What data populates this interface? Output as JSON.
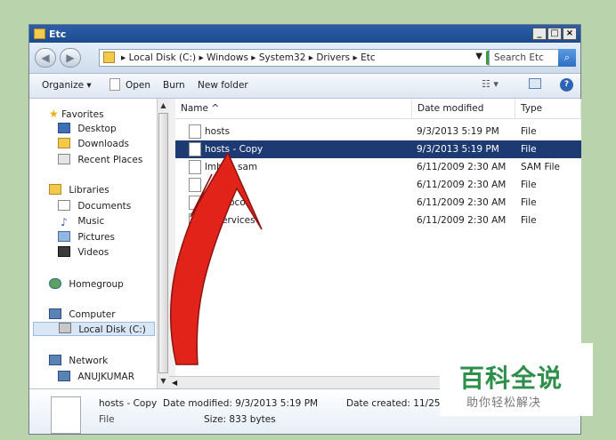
{
  "window": {
    "title": "Etc",
    "buttons": [
      "_",
      "□",
      "×"
    ]
  },
  "address": {
    "path": "▸ Local Disk (C:) ▸ Windows ▸ System32 ▸ Drivers ▸ Etc",
    "search_placeholder": "Search Etc"
  },
  "toolbar": {
    "organize": "Organize ▾",
    "open": "Open",
    "burn": "Burn",
    "new_folder": "New folder",
    "help": "?"
  },
  "sidebar": {
    "favorites": "Favorites",
    "desktop": "Desktop",
    "downloads": "Downloads",
    "recent": "Recent Places",
    "libraries": "Libraries",
    "documents": "Documents",
    "music": "Music",
    "pictures": "Pictures",
    "videos": "Videos",
    "homegroup": "Homegroup",
    "computer": "Computer",
    "local_disk": "Local Disk (C:)",
    "network": "Network",
    "anujkumar": "ANUJKUMAR"
  },
  "columns": {
    "name": "Name ^",
    "date": "Date modified",
    "type": "Type"
  },
  "files": [
    {
      "name": "hosts",
      "date": "9/3/2013 5:19 PM",
      "type": "File"
    },
    {
      "name": "hosts - Copy",
      "date": "9/3/2013 5:19 PM",
      "type": "File"
    },
    {
      "name": "lmh",
      "name2": "sam",
      "date": "6/11/2009 2:30 AM",
      "type": "SAM File"
    },
    {
      "name": "",
      "date": "6/11/2009 2:30 AM",
      "type": "File"
    },
    {
      "name": "toco",
      "date": "6/11/2009 2:30 AM",
      "type": "File"
    },
    {
      "name": "ervices",
      "date": "6/11/2009 2:30 AM",
      "type": "File"
    }
  ],
  "details": {
    "name": "hosts - Copy",
    "kind": "File",
    "modified": "Date modified: 9/3/2013 5:19 PM",
    "size": "Size: 833 bytes",
    "created": "Date created: 11/25/2"
  },
  "watermark": {
    "title": "百科全说",
    "subtitle": "助你轻松解决"
  },
  "colors": {
    "selection": "#1e3a73",
    "arrow": "#e2231a",
    "background": "#b9d3ad",
    "watermark_green": "#2e8f4a"
  }
}
